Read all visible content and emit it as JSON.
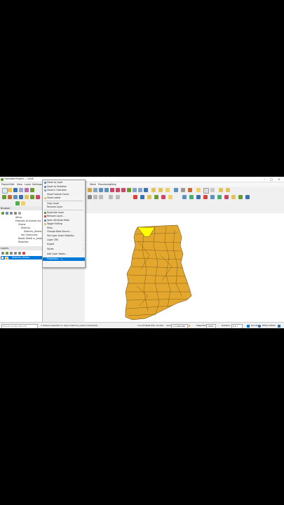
{
  "window": {
    "title": "*Untitled Project — QGIS"
  },
  "menu": [
    "Project",
    "Edit",
    "View",
    "Layer",
    "Settings",
    "Plugins",
    "Vector",
    "Raster",
    "Database",
    "Web",
    "Mesh",
    "Processing",
    "Help"
  ],
  "browser": {
    "title": "Browser",
    "items": [
      "Africa",
      "Features of Kumasi Sur",
      "Ghana",
      "Districts",
      "Districts_Ghana.shp",
      "Vol_Ghana.shp",
      "Roads (Reef) in_project",
      "Favorites"
    ]
  },
  "layers": {
    "title": "Layers",
    "layer_name": "Districts_Ghana"
  },
  "context_menu": {
    "items": [
      {
        "label": "Zoom to Layer",
        "has_icon": true
      },
      {
        "label": "Zoom to Selection",
        "has_icon": true
      },
      {
        "label": "Show in Overview",
        "has_icon": true
      },
      {
        "label": "Show Feature Count",
        "has_icon": false
      },
      {
        "label": "Show Labels",
        "has_icon": true
      },
      {
        "sep": true
      },
      {
        "label": "Copy Layer",
        "has_icon": false
      },
      {
        "label": "Rename Layer",
        "has_icon": false
      },
      {
        "sep": true
      },
      {
        "label": "Duplicate Layer",
        "has_icon": true
      },
      {
        "label": "Remove Layer...",
        "has_icon": true
      },
      {
        "label": "Open Attribute Table",
        "has_icon": true
      },
      {
        "label": "Toggle Editing",
        "has_icon": true
      },
      {
        "label": "Filter...",
        "has_icon": false
      },
      {
        "label": "Change Data Source...",
        "has_icon": false
      },
      {
        "label": "Set Layer Scale Visibility...",
        "has_icon": false
      },
      {
        "label": "Layer CRS",
        "has_icon": false,
        "submenu": true
      },
      {
        "label": "Export",
        "has_icon": false,
        "submenu": true
      },
      {
        "label": "Styles",
        "has_icon": false,
        "submenu": true
      },
      {
        "label": "Add Layer Notes...",
        "has_icon": false
      },
      {
        "label": "Properties...",
        "has_icon": false,
        "selected": true
      }
    ]
  },
  "status": {
    "search_placeholder": "Type to locate (Ctrl+K)",
    "message": "1 feature selected on layer Districts_Ghana (Selected)",
    "coordinate_label": "Coordinate",
    "coordinate": "-0.659, 10.920",
    "scale_label": "Scale",
    "scale": "1:2,000,000",
    "magnifier_label": "Magnifier",
    "magnifier": "100%",
    "rotation_label": "Rotation",
    "rotation": "0.0 °",
    "render_label": "Render",
    "crs": "EPSG:32630"
  },
  "colors": {
    "fill": "#e4a72e",
    "selected": "#ffff00",
    "stroke": "#5a4010",
    "accent": "#0078d7"
  }
}
